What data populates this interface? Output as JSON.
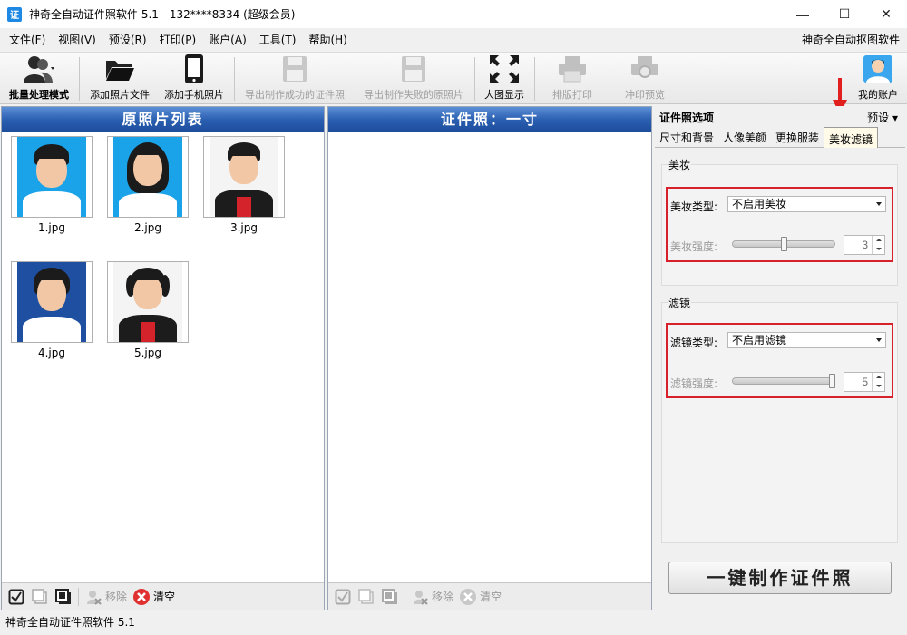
{
  "window": {
    "title": "神奇全自动证件照软件 5.1 - 132****8334 (超级会员)",
    "app_icon_text": "证",
    "controls": {
      "minimize": "—",
      "maximize": "☐",
      "close": "✕"
    }
  },
  "menu": {
    "items": [
      "文件(F)",
      "视图(V)",
      "预设(R)",
      "打印(P)",
      "账户(A)",
      "工具(T)",
      "帮助(H)"
    ],
    "right_link": "神奇全自动抠图软件"
  },
  "toolbar": {
    "batch_mode": "批量处理模式",
    "add_photo_file": "添加照片文件",
    "add_phone_photo": "添加手机照片",
    "export_success": "导出制作成功的证件照",
    "export_failed": "导出制作失败的原照片",
    "big_view": "大图显示",
    "layout_print": "排版打印",
    "print_preview": "冲印预览",
    "my_account": "我的账户"
  },
  "left_panel": {
    "title": "原照片列表",
    "photos": [
      {
        "filename": "1.jpg"
      },
      {
        "filename": "2.jpg"
      },
      {
        "filename": "3.jpg"
      },
      {
        "filename": "4.jpg"
      },
      {
        "filename": "5.jpg"
      }
    ],
    "bottom": {
      "remove": "移除",
      "clear": "清空"
    }
  },
  "center_panel": {
    "title": "证件照：一寸",
    "bottom": {
      "remove": "移除",
      "clear": "清空"
    }
  },
  "right_panel": {
    "title": "证件照选项",
    "preset": "预设",
    "tabs": [
      "尺寸和背景",
      "人像美颜",
      "更换服装",
      "美妆滤镜"
    ],
    "active_tab": "美妆滤镜",
    "makeup": {
      "group_title": "美妆",
      "type_label": "美妆类型:",
      "type_value": "不启用美妆",
      "strength_label": "美妆强度:",
      "strength_value": "3",
      "strength_fraction": 0.5
    },
    "filter": {
      "group_title": "滤镜",
      "type_label": "滤镜类型:",
      "type_value": "不启用滤镜",
      "strength_label": "滤镜强度:",
      "strength_value": "5",
      "strength_fraction": 1.0
    },
    "make_button": "一键制作证件照"
  },
  "status": {
    "text": "神奇全自动证件照软件 5.1"
  },
  "colors": {
    "header_blue": "#2b5fb1",
    "highlight_red": "#d8202a",
    "active_tab_bg": "#fffbe8"
  }
}
